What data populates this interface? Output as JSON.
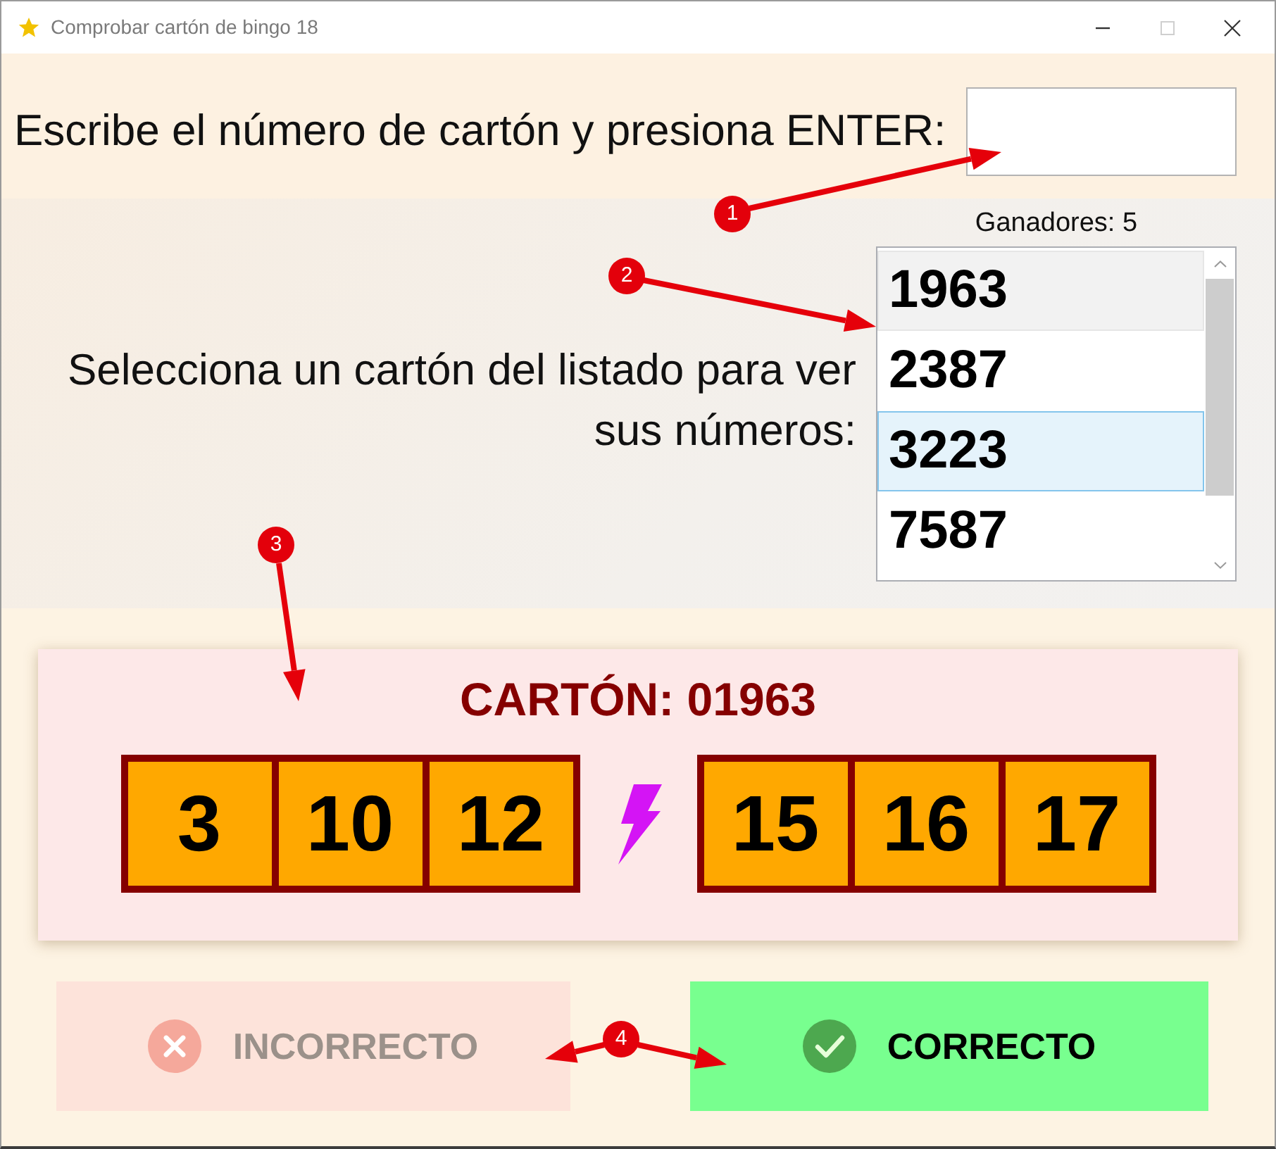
{
  "window": {
    "title": "Comprobar cartón de bingo 18",
    "controls": [
      {
        "kind": "minimize",
        "disabled": false
      },
      {
        "kind": "maximize",
        "disabled": true
      },
      {
        "kind": "close",
        "disabled": false
      }
    ]
  },
  "entry": {
    "label": "Escribe el número de cartón y presiona ENTER:"
  },
  "winners": {
    "label": "Ganadores: 5"
  },
  "select_prompt": "Selecciona un cartón del listado para ver sus números:",
  "card_list": [
    {
      "number": "1963",
      "selected": false,
      "hovered": true
    },
    {
      "number": "2387",
      "selected": false,
      "hovered": false
    },
    {
      "number": "3223",
      "selected": true,
      "hovered": false
    },
    {
      "number": "7587",
      "selected": false,
      "hovered": false
    }
  ],
  "card": {
    "title": "CARTÓN: 01963",
    "number_groups": [
      [
        "3",
        "10",
        "12"
      ],
      [
        "15",
        "16",
        "17"
      ]
    ]
  },
  "buttons": [
    {
      "kind": "incorrect",
      "label": "INCORRECTO",
      "disabled": true
    },
    {
      "kind": "correct",
      "label": "CORRECTO",
      "disabled": false
    }
  ],
  "callouts": [
    {
      "label": "1"
    },
    {
      "label": "2"
    },
    {
      "label": "3"
    },
    {
      "label": "4"
    }
  ]
}
